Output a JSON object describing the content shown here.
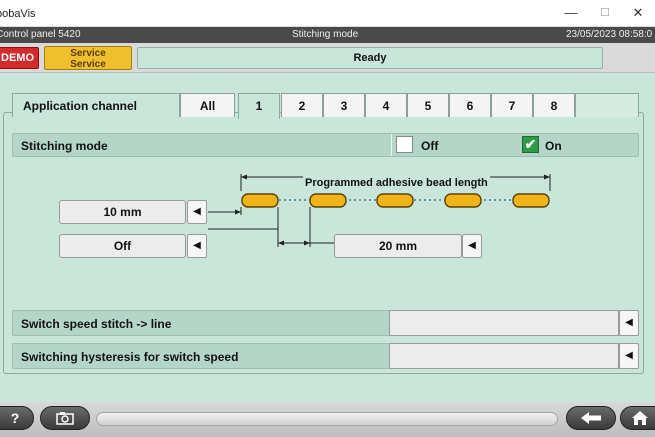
{
  "window": {
    "app_title": "bobaVis",
    "minimize": "—",
    "maximize": "☐",
    "close": "✕"
  },
  "infobar": {
    "panel": "Control panel 5420",
    "mode": "Stitching mode",
    "datetime": "23/05/2023 08:58:0"
  },
  "status": {
    "demo": "DEMO",
    "service_line1": "Service",
    "service_line2": "Service",
    "ready": "Ready"
  },
  "tabs": {
    "header": "Application channel",
    "items": [
      "All",
      "1",
      "2",
      "3",
      "4",
      "5",
      "6",
      "7",
      "8"
    ],
    "active": "1"
  },
  "stitching": {
    "label": "Stitching mode",
    "off_label": "Off",
    "on_label": "On",
    "off_checked": false,
    "on_checked": true
  },
  "diagram": {
    "bead_label": "Programmed adhesive bead length",
    "bead_color": "#f0b418"
  },
  "fields": {
    "distance_value": "10 mm",
    "offset_value": "Off",
    "gap_value": "20 mm"
  },
  "switch_speed": {
    "label": "Switch speed stitch -> line",
    "value": ""
  },
  "hysteresis": {
    "label": "Switching hysteresis for switch speed",
    "value": ""
  },
  "bottom": {
    "help_label": "?"
  },
  "icons": [
    "minimize-icon",
    "maximize-icon",
    "close-icon",
    "camera-icon",
    "back-arrow-icon",
    "home-icon",
    "arrow-left-icon",
    "check-icon"
  ]
}
